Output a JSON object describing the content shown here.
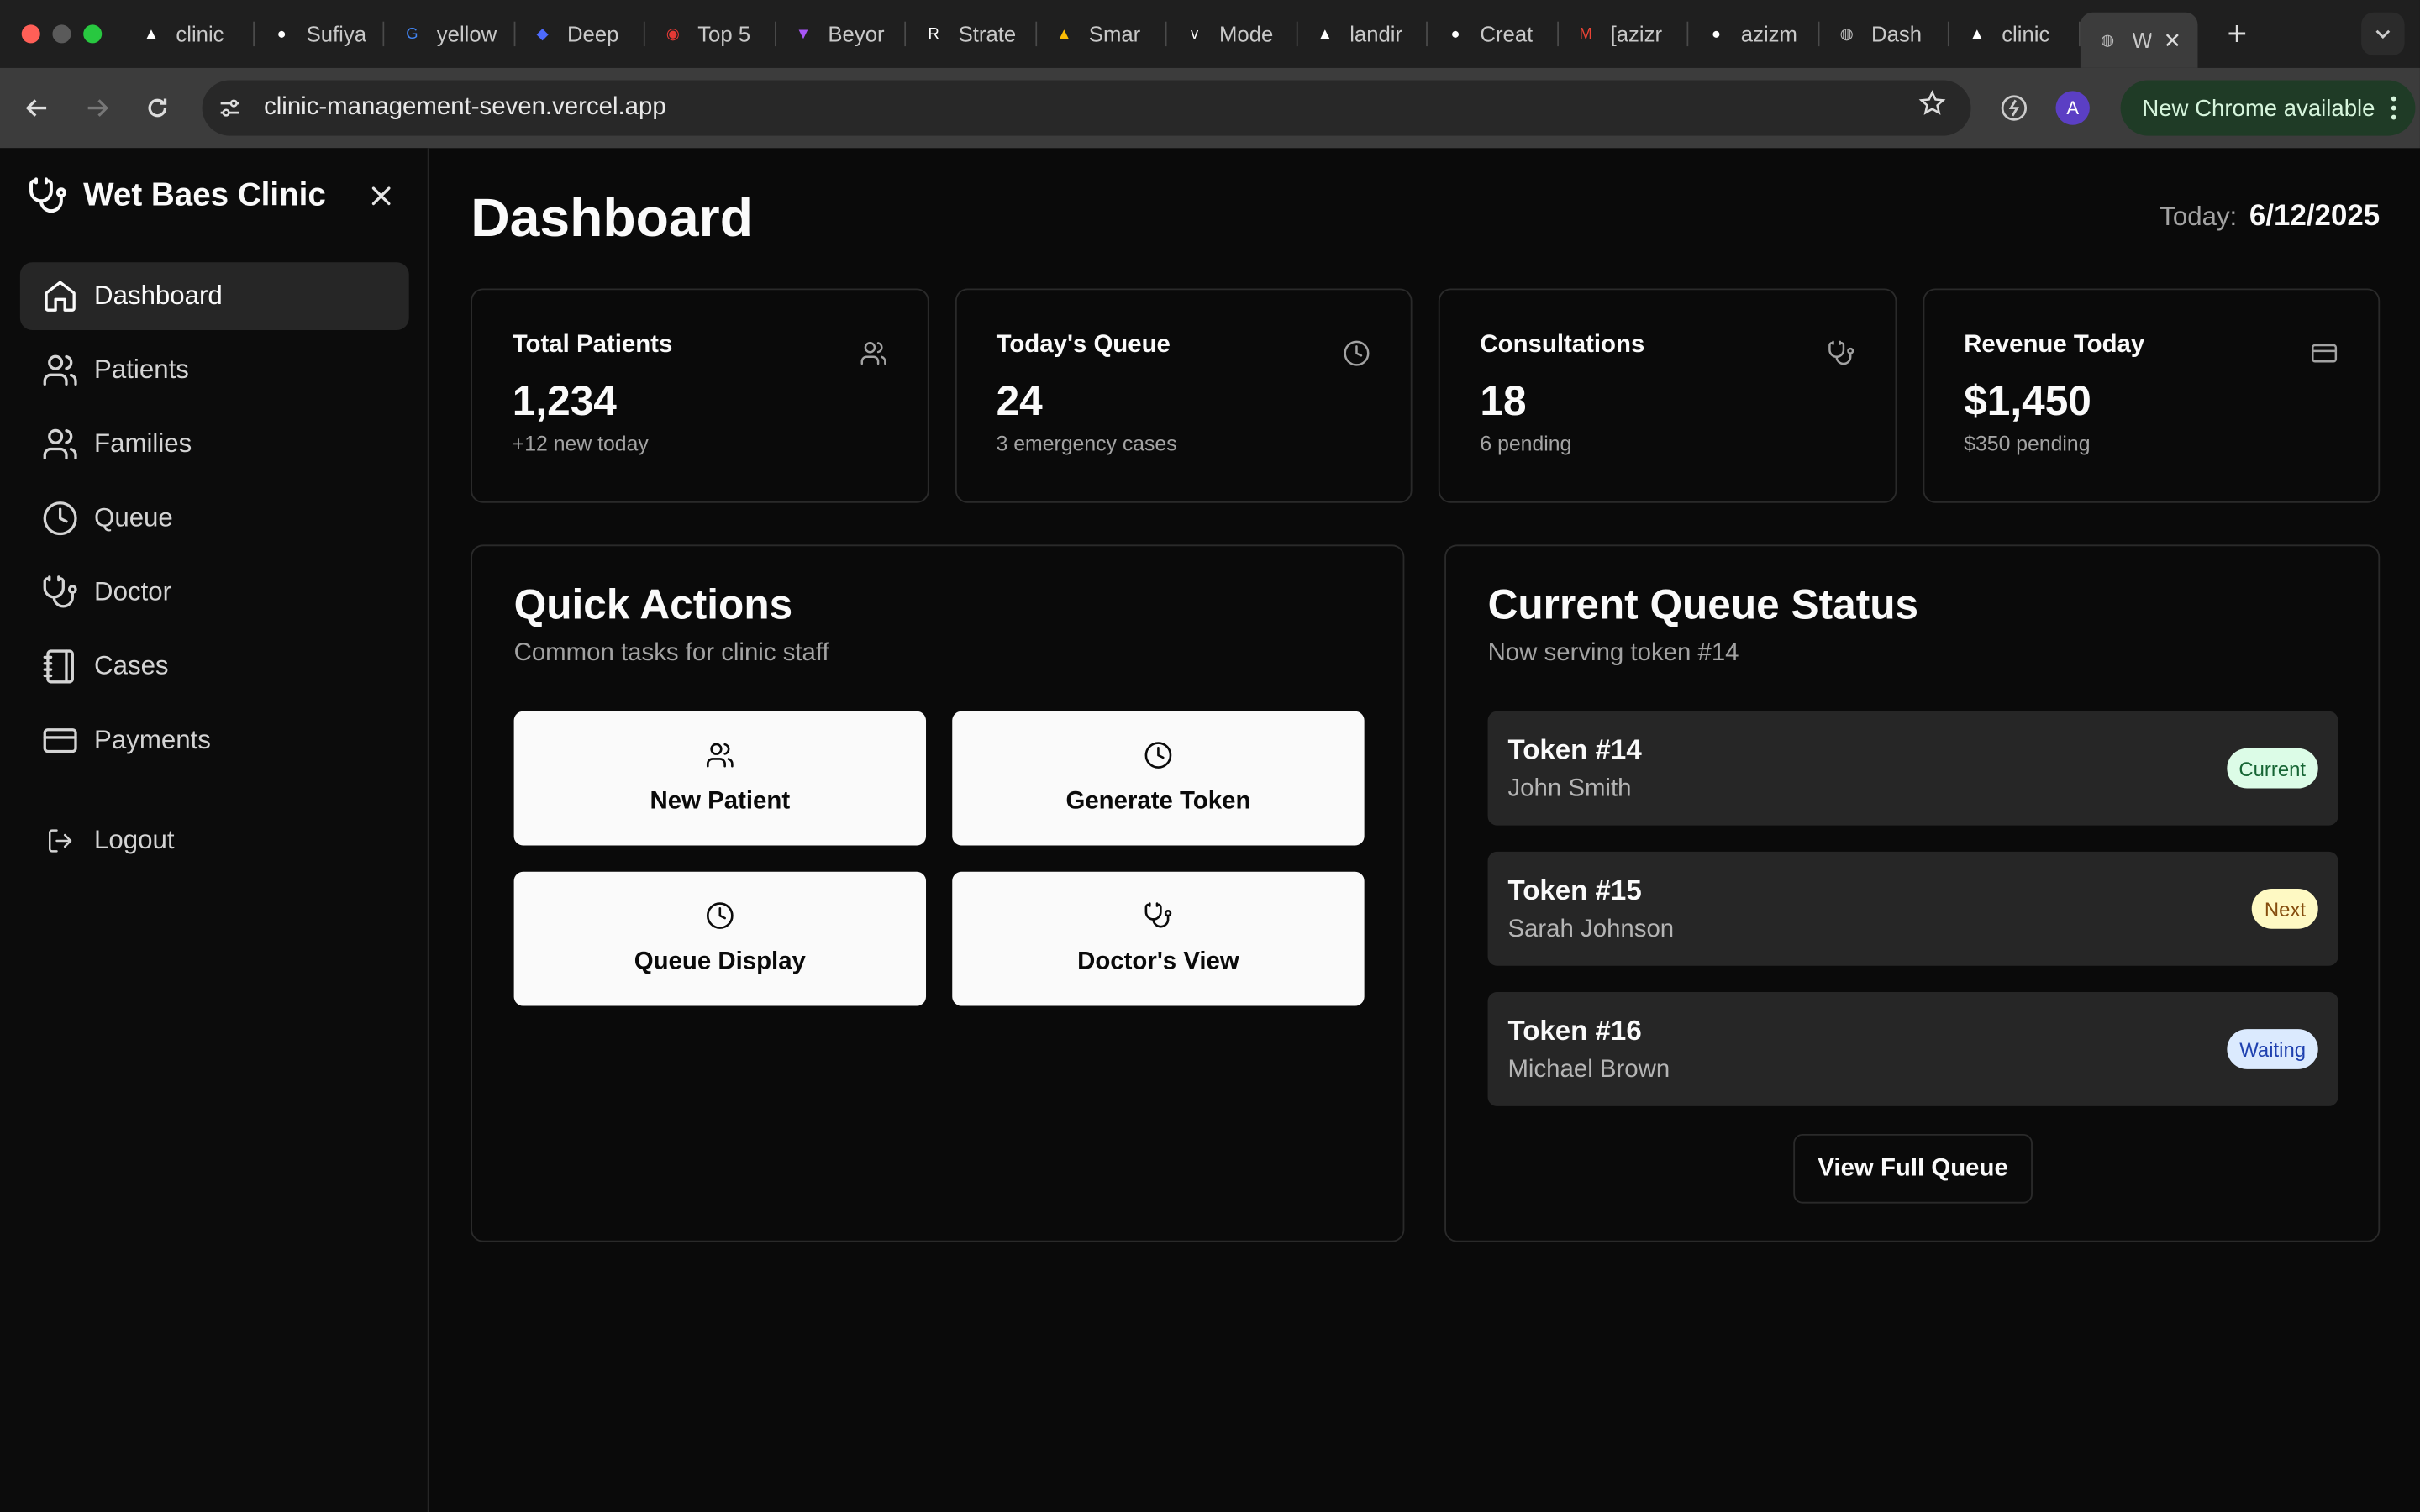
{
  "browser": {
    "tabs": [
      {
        "title": "clinic",
        "icon": "vercel-icon",
        "color": "#ffffff"
      },
      {
        "title": "Sufiya",
        "icon": "github-icon",
        "color": "#ffffff"
      },
      {
        "title": "yellow",
        "icon": "google-icon",
        "color": "#4285f4"
      },
      {
        "title": "Deep",
        "icon": "deepseek-icon",
        "color": "#4d6bfe"
      },
      {
        "title": "Top 5",
        "icon": "record-icon",
        "color": "#e53935"
      },
      {
        "title": "Beyor",
        "icon": "vite-icon",
        "color": "#a855f7"
      },
      {
        "title": "Strate",
        "icon": "r-icon",
        "color": "#ffffff"
      },
      {
        "title": "Smar",
        "icon": "ads-icon",
        "color": "#fbbc04"
      },
      {
        "title": "Mode",
        "icon": "v0-icon",
        "color": "#ffffff"
      },
      {
        "title": "landir",
        "icon": "vercel-icon",
        "color": "#ffffff"
      },
      {
        "title": "Creat",
        "icon": "github-icon",
        "color": "#ffffff"
      },
      {
        "title": "[azizr",
        "icon": "gmail-icon",
        "color": "#ea4335"
      },
      {
        "title": "azizm",
        "icon": "github-icon",
        "color": "#ffffff"
      },
      {
        "title": "Dash",
        "icon": "globe-icon",
        "color": "#bbbbbb"
      },
      {
        "title": "clinic",
        "icon": "vercel-icon",
        "color": "#ffffff"
      },
      {
        "title": "W",
        "icon": "globe-icon",
        "color": "#bbbbbb"
      }
    ],
    "url": "clinic-management-seven.vercel.app",
    "profile_initial": "A",
    "update_label": "New Chrome available"
  },
  "sidebar": {
    "brand": "Wet Baes Clinic",
    "items": [
      {
        "label": "Dashboard",
        "icon": "home-icon"
      },
      {
        "label": "Patients",
        "icon": "users-icon"
      },
      {
        "label": "Families",
        "icon": "users-icon"
      },
      {
        "label": "Queue",
        "icon": "clock-icon"
      },
      {
        "label": "Doctor",
        "icon": "stethoscope-icon"
      },
      {
        "label": "Cases",
        "icon": "notebook-icon"
      },
      {
        "label": "Payments",
        "icon": "credit-card-icon"
      }
    ],
    "logout": "Logout"
  },
  "header": {
    "title": "Dashboard",
    "today_label": "Today:",
    "today_value": "6/12/2025"
  },
  "stats": [
    {
      "title": "Total Patients",
      "value": "1,234",
      "sub": "+12 new today",
      "icon": "users-icon"
    },
    {
      "title": "Today's Queue",
      "value": "24",
      "sub": "3 emergency cases",
      "icon": "clock-icon"
    },
    {
      "title": "Consultations",
      "value": "18",
      "sub": "6 pending",
      "icon": "stethoscope-icon"
    },
    {
      "title": "Revenue Today",
      "value": "$1,450",
      "sub": "$350 pending",
      "icon": "credit-card-icon"
    }
  ],
  "quick_actions": {
    "title": "Quick Actions",
    "subtitle": "Common tasks for clinic staff",
    "buttons": [
      {
        "label": "New Patient",
        "icon": "users-icon"
      },
      {
        "label": "Generate Token",
        "icon": "clock-icon"
      },
      {
        "label": "Queue Display",
        "icon": "clock-icon"
      },
      {
        "label": "Doctor's View",
        "icon": "stethoscope-icon"
      }
    ]
  },
  "queue_status": {
    "title": "Current Queue Status",
    "subtitle": "Now serving token #14",
    "rows": [
      {
        "token": "Token #14",
        "name": "John Smith",
        "status": "Current"
      },
      {
        "token": "Token #15",
        "name": "Sarah Johnson",
        "status": "Next"
      },
      {
        "token": "Token #16",
        "name": "Michael Brown",
        "status": "Waiting"
      }
    ],
    "view_full": "View Full Queue"
  }
}
